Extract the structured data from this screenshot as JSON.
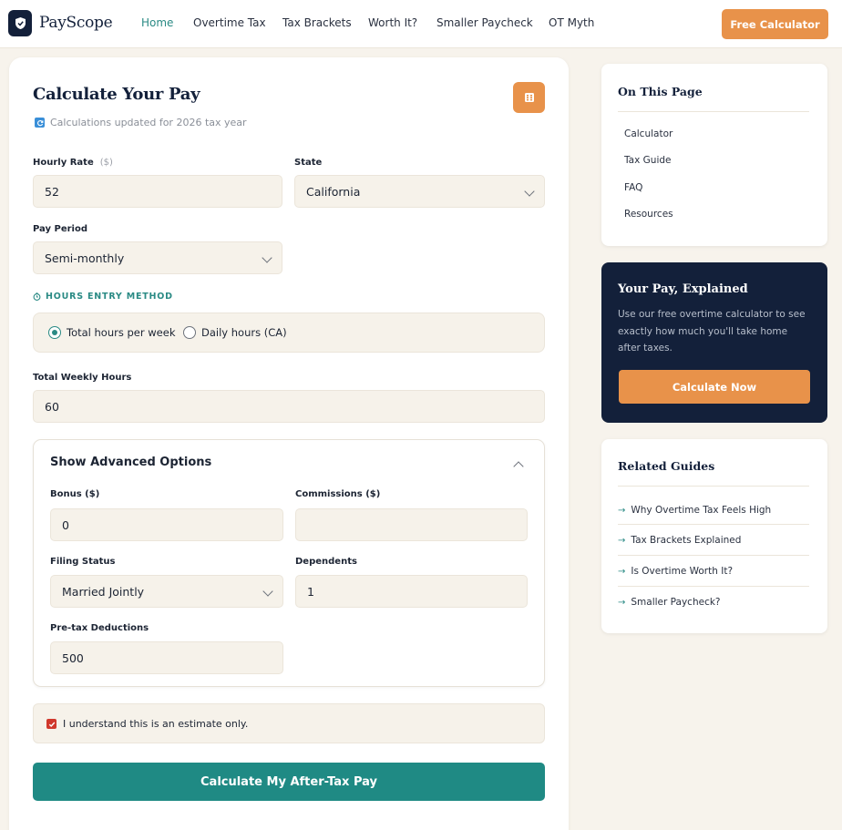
{
  "brand": {
    "name": "PayScope",
    "logo_icon": "shield-icon"
  },
  "nav": {
    "items": [
      "Home",
      "Overtime Tax",
      "Tax Brackets",
      "Worth It?",
      "Smaller Paycheck",
      "OT Myth"
    ],
    "active": "Home",
    "cta": "Free Calculator"
  },
  "calculator": {
    "title": "Calculate Your Pay",
    "updated": "Calculations updated for 2026 tax year",
    "hourly_rate": {
      "label": "Hourly Rate",
      "hint": "($)",
      "value": "52"
    },
    "state": {
      "label": "State",
      "value": "California"
    },
    "pay_period": {
      "label": "Pay Period",
      "value": "Semi-monthly"
    },
    "hours_method": {
      "label": "HOURS ENTRY METHOD",
      "options": [
        "Total hours per week",
        "Daily hours (CA)"
      ],
      "selected": "Total hours per week"
    },
    "weekly_hours": {
      "label": "Total Weekly Hours",
      "value": "60"
    },
    "advanced": {
      "title": "Show Advanced Options",
      "bonus": {
        "label": "Bonus ($)",
        "value": "0"
      },
      "commissions": {
        "label": "Commissions ($)",
        "value": ""
      },
      "filing_status": {
        "label": "Filing Status",
        "value": "Married Jointly"
      },
      "dependents": {
        "label": "Dependents",
        "value": "1"
      },
      "pretax": {
        "label": "Pre-tax Deductions",
        "value": "500"
      }
    },
    "disclaimer": {
      "text": "I understand this is an estimate only.",
      "checked": true
    },
    "submit": "Calculate My After-Tax Pay"
  },
  "sidebar": {
    "toc": {
      "title": "On This Page",
      "items": [
        "Calculator",
        "Tax Guide",
        "FAQ",
        "Resources"
      ]
    },
    "explain": {
      "title": "Your Pay, Explained",
      "text": "Use our free overtime calculator to see exactly how much you'll take home after taxes.",
      "button": "Calculate Now"
    },
    "related": {
      "title": "Related Guides",
      "items": [
        "Why Overtime Tax Feels High",
        "Tax Brackets Explained",
        "Is Overtime Worth It?",
        "Smaller Paycheck?"
      ]
    }
  },
  "colors": {
    "navy": "#13203a",
    "orange": "#e8924a",
    "teal": "#1f8a84",
    "cream": "#f7f3ec"
  }
}
